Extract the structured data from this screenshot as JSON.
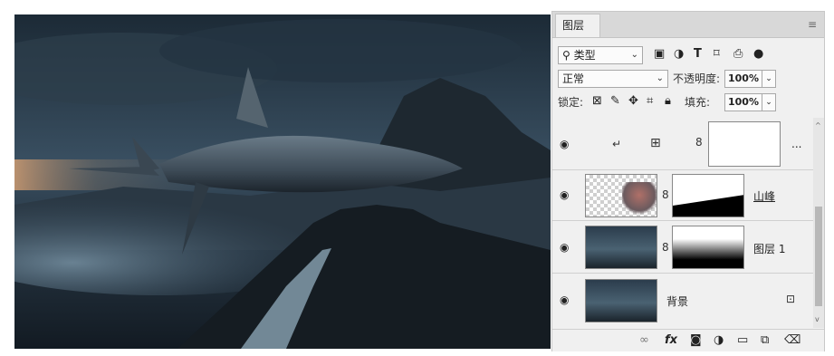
{
  "panel": {
    "tab_label": "图层",
    "menu_icon": "hamburger-menu-icon"
  },
  "filter": {
    "kind_label": "类型",
    "icons": [
      "image-filter-icon",
      "adjustment-filter-icon",
      "type-filter-icon",
      "shape-filter-icon",
      "smart-object-filter-icon",
      "filter-toggle-icon"
    ]
  },
  "blend": {
    "mode": "正常",
    "opacity_label": "不透明度:",
    "opacity_value": "100%"
  },
  "lock": {
    "label": "锁定:",
    "fill_label": "填充:",
    "fill_value": "100%"
  },
  "layers": [
    {
      "name": "",
      "type": "adjustment",
      "clipped": true,
      "more": "..."
    },
    {
      "name": "山峰",
      "type": "masked-image"
    },
    {
      "name": "图层 1",
      "type": "masked-image"
    },
    {
      "name": "背景",
      "type": "background",
      "locked": true
    }
  ],
  "footer_icons": [
    "link-layers-icon",
    "fx-icon",
    "add-mask-icon",
    "new-adjustment-icon",
    "new-group-icon",
    "new-layer-icon",
    "delete-layer-icon"
  ],
  "footer": {
    "fx_label": "fx"
  },
  "colors": {
    "panel_bg": "#f0f0f0",
    "canvas_sky": "#2b3c4c"
  }
}
